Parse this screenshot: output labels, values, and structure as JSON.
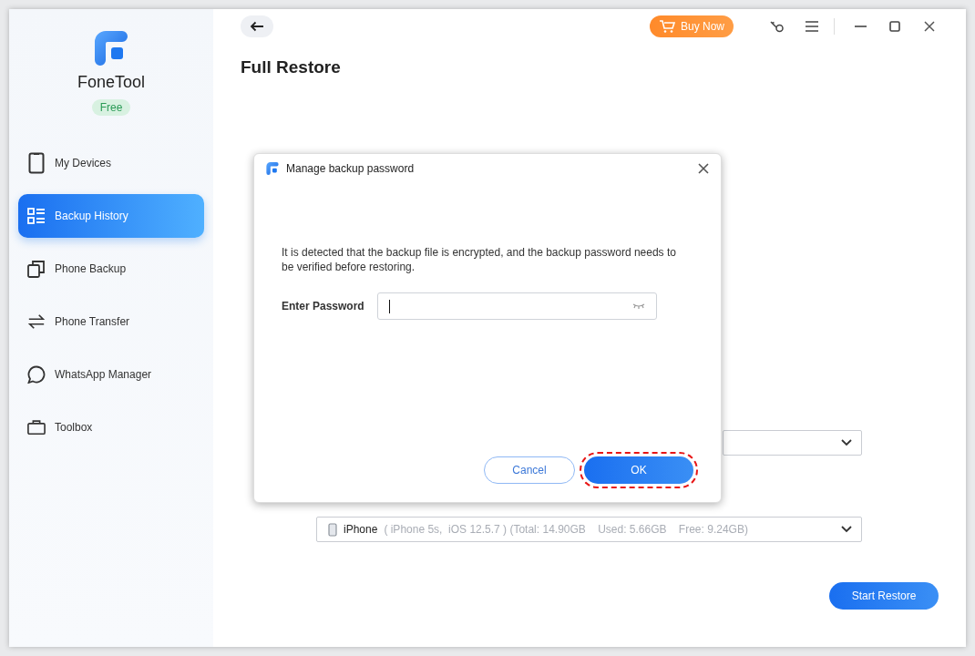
{
  "app": {
    "name": "FoneTool",
    "edition": "Free"
  },
  "sidebar": {
    "items": [
      {
        "label": "My Devices",
        "selected": false
      },
      {
        "label": "Backup History",
        "selected": true
      },
      {
        "label": "Phone Backup",
        "selected": false
      },
      {
        "label": "Phone Transfer",
        "selected": false
      },
      {
        "label": "WhatsApp Manager",
        "selected": false
      },
      {
        "label": "Toolbox",
        "selected": false
      }
    ]
  },
  "header": {
    "buy_button": "Buy Now"
  },
  "page": {
    "title": "Full Restore",
    "restore_target": {
      "device": "iPhone",
      "details": "( iPhone 5s,  iOS 12.5.7 ) (Total: 14.90GB    Used: 5.66GB    Free: 9.24GB)"
    },
    "start_button": "Start Restore"
  },
  "dialog": {
    "title": "Manage backup password",
    "message": "It is detected that the backup file is encrypted, and the backup password needs to be verified before restoring.",
    "password_label": "Enter Password",
    "password_focused": true,
    "buttons": [
      {
        "label": "Cancel",
        "kind": "secondary",
        "highlighted": false
      },
      {
        "label": "OK",
        "kind": "primary",
        "highlighted": true
      }
    ]
  }
}
